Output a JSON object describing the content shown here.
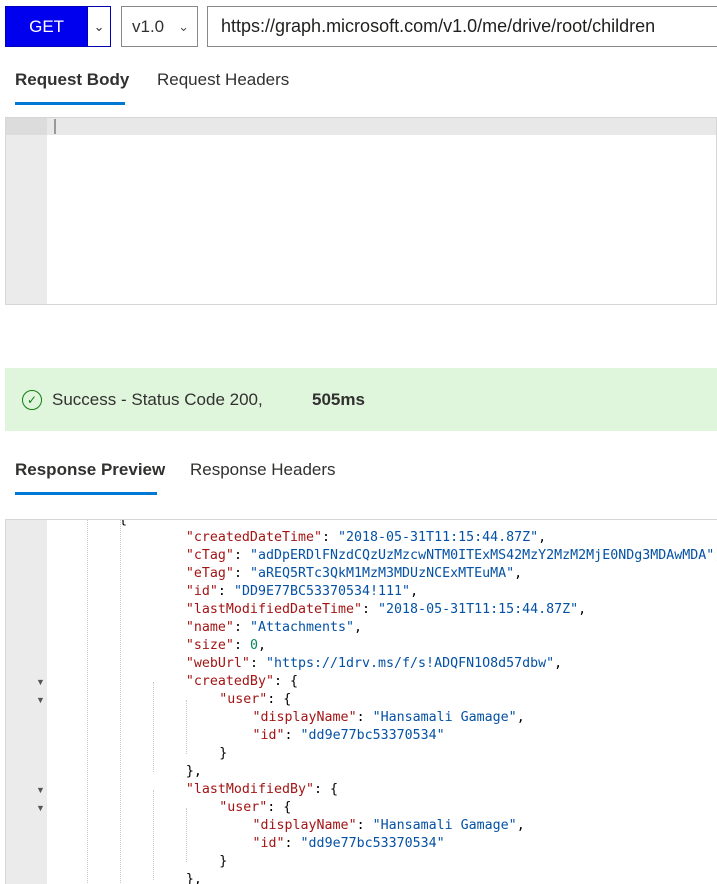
{
  "toolbar": {
    "method": "GET",
    "version": "v1.0",
    "url": "https://graph.microsoft.com/v1.0/me/drive/root/children"
  },
  "request_tabs": [
    "Request Body",
    "Request Headers"
  ],
  "status": {
    "message": "Success - Status Code 200,",
    "time": "505ms"
  },
  "response_tabs": [
    "Response Preview",
    "Response Headers"
  ],
  "response_lines": [
    {
      "indent": 0,
      "parts": [
        [
          "p",
          "{"
        ]
      ]
    },
    {
      "indent": 3,
      "parts": [
        [
          "k",
          "\"createdDateTime\""
        ],
        [
          "p",
          ": "
        ],
        [
          "s",
          "\"2018-05-31T11:15:44.87Z\""
        ],
        [
          "p",
          ","
        ]
      ]
    },
    {
      "indent": 3,
      "parts": [
        [
          "k",
          "\"cTag\""
        ],
        [
          "p",
          ": "
        ],
        [
          "s",
          "\"adDpERDlFNzdCQzUzMzcwNTM0ITExMS42MzY2MzM2MjE0NDg3MDAwMDA\""
        ],
        [
          "p",
          ","
        ]
      ]
    },
    {
      "indent": 3,
      "parts": [
        [
          "k",
          "\"eTag\""
        ],
        [
          "p",
          ": "
        ],
        [
          "s",
          "\"aREQ5RTc3QkM1MzM3MDUzNCExMTEuMA\""
        ],
        [
          "p",
          ","
        ]
      ]
    },
    {
      "indent": 3,
      "parts": [
        [
          "k",
          "\"id\""
        ],
        [
          "p",
          ": "
        ],
        [
          "s",
          "\"DD9E77BC53370534!111\""
        ],
        [
          "p",
          ","
        ]
      ]
    },
    {
      "indent": 3,
      "parts": [
        [
          "k",
          "\"lastModifiedDateTime\""
        ],
        [
          "p",
          ": "
        ],
        [
          "s",
          "\"2018-05-31T11:15:44.87Z\""
        ],
        [
          "p",
          ","
        ]
      ]
    },
    {
      "indent": 3,
      "parts": [
        [
          "k",
          "\"name\""
        ],
        [
          "p",
          ": "
        ],
        [
          "s",
          "\"Attachments\""
        ],
        [
          "p",
          ","
        ]
      ]
    },
    {
      "indent": 3,
      "parts": [
        [
          "k",
          "\"size\""
        ],
        [
          "p",
          ": "
        ],
        [
          "n",
          "0"
        ],
        [
          "p",
          ","
        ]
      ]
    },
    {
      "indent": 3,
      "parts": [
        [
          "k",
          "\"webUrl\""
        ],
        [
          "p",
          ": "
        ],
        [
          "s",
          "\"https://1drv.ms/f/s!ADQFN1O8d57dbw\""
        ],
        [
          "p",
          ","
        ]
      ]
    },
    {
      "indent": 3,
      "fold": true,
      "parts": [
        [
          "k",
          "\"createdBy\""
        ],
        [
          "p",
          ": {"
        ]
      ]
    },
    {
      "indent": 4,
      "fold": true,
      "parts": [
        [
          "k",
          "\"user\""
        ],
        [
          "p",
          ": {"
        ]
      ]
    },
    {
      "indent": 5,
      "parts": [
        [
          "k",
          "\"displayName\""
        ],
        [
          "p",
          ": "
        ],
        [
          "s",
          "\"Hansamali Gamage\""
        ],
        [
          "p",
          ","
        ]
      ]
    },
    {
      "indent": 5,
      "parts": [
        [
          "k",
          "\"id\""
        ],
        [
          "p",
          ": "
        ],
        [
          "s",
          "\"dd9e77bc53370534\""
        ]
      ]
    },
    {
      "indent": 4,
      "parts": [
        [
          "p",
          "}"
        ]
      ]
    },
    {
      "indent": 3,
      "parts": [
        [
          "p",
          "},"
        ]
      ]
    },
    {
      "indent": 3,
      "fold": true,
      "parts": [
        [
          "k",
          "\"lastModifiedBy\""
        ],
        [
          "p",
          ": {"
        ]
      ]
    },
    {
      "indent": 4,
      "fold": true,
      "parts": [
        [
          "k",
          "\"user\""
        ],
        [
          "p",
          ": {"
        ]
      ]
    },
    {
      "indent": 5,
      "parts": [
        [
          "k",
          "\"displayName\""
        ],
        [
          "p",
          ": "
        ],
        [
          "s",
          "\"Hansamali Gamage\""
        ],
        [
          "p",
          ","
        ]
      ]
    },
    {
      "indent": 5,
      "parts": [
        [
          "k",
          "\"id\""
        ],
        [
          "p",
          ": "
        ],
        [
          "s",
          "\"dd9e77bc53370534\""
        ]
      ]
    },
    {
      "indent": 4,
      "parts": [
        [
          "p",
          "}"
        ]
      ]
    },
    {
      "indent": 3,
      "parts": [
        [
          "p",
          "},"
        ]
      ]
    }
  ],
  "colors": {
    "accent": "#0078d4",
    "method_button": "#0000ee",
    "success_bg": "#dff6dd",
    "success_icon": "#107c10"
  },
  "icons": [
    "chevron-down-icon",
    "success-check-icon",
    "fold-arrow-icon"
  ]
}
